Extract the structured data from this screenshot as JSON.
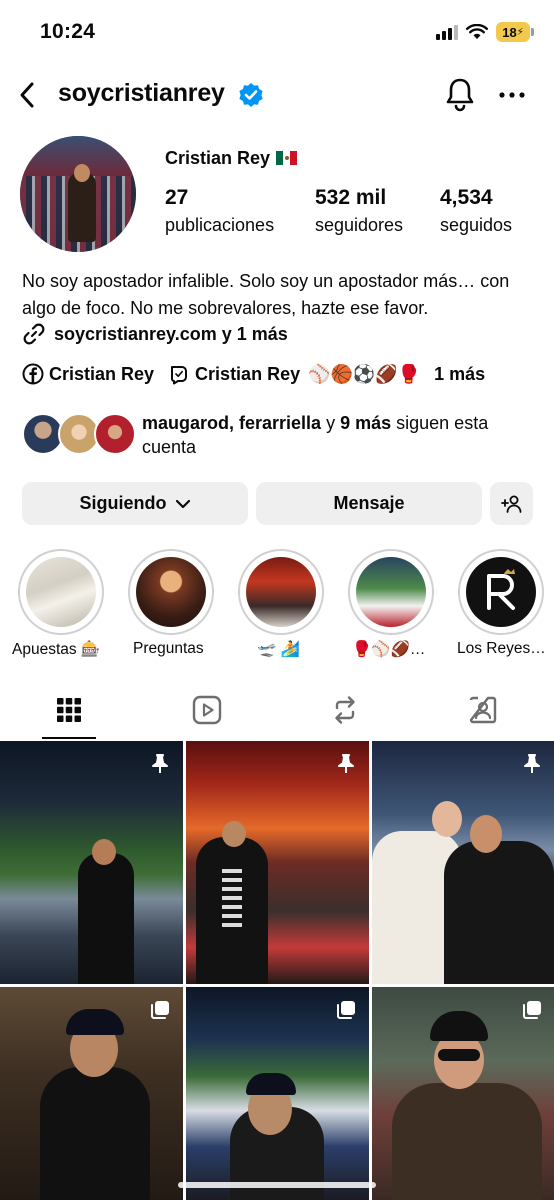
{
  "status_bar": {
    "time": "10:24",
    "battery": "18"
  },
  "header": {
    "username": "soycristianrey"
  },
  "profile": {
    "name": "Cristian Rey",
    "stats": [
      {
        "value": "27",
        "label": "publicaciones"
      },
      {
        "value": "532 mil",
        "label": "seguidores"
      },
      {
        "value": "4,534",
        "label": "seguidos"
      }
    ],
    "bio": "No soy apostador infalible. Solo soy un apostador más… con algo de foco. No me sobrevalores, hazte ese favor.",
    "link": "soycristianrey.com y 1 más",
    "facebook_label": "Cristian Rey",
    "threads_label": "Cristian Rey",
    "sport_emojis": "⚾🏀⚽🏈🥊",
    "more_label": "1 más",
    "followers_names": "maugarod, ferarriella",
    "followers_mid": " y ",
    "followers_count": "9 más",
    "followers_suffix": " siguen esta cuenta"
  },
  "buttons": {
    "following": "Siguiendo",
    "message": "Mensaje"
  },
  "highlights": [
    {
      "label": "Apuestas 🎰"
    },
    {
      "label": "Preguntas"
    },
    {
      "label": "🛫 🏄"
    },
    {
      "label": "🥊⚾🏈…"
    },
    {
      "label": "Los Reyes…"
    }
  ],
  "colors": {
    "verified": "#0095f6",
    "button_bg": "#efefef",
    "text": "#0a0a0a"
  },
  "icons": {
    "tabs": [
      "grid-icon",
      "reels-icon",
      "reposts-icon",
      "tagged-icon"
    ],
    "grid_badges": [
      "pin-icon",
      "pin-icon",
      "pin-icon",
      "carousel-icon",
      "carousel-icon",
      "carousel-icon"
    ]
  }
}
